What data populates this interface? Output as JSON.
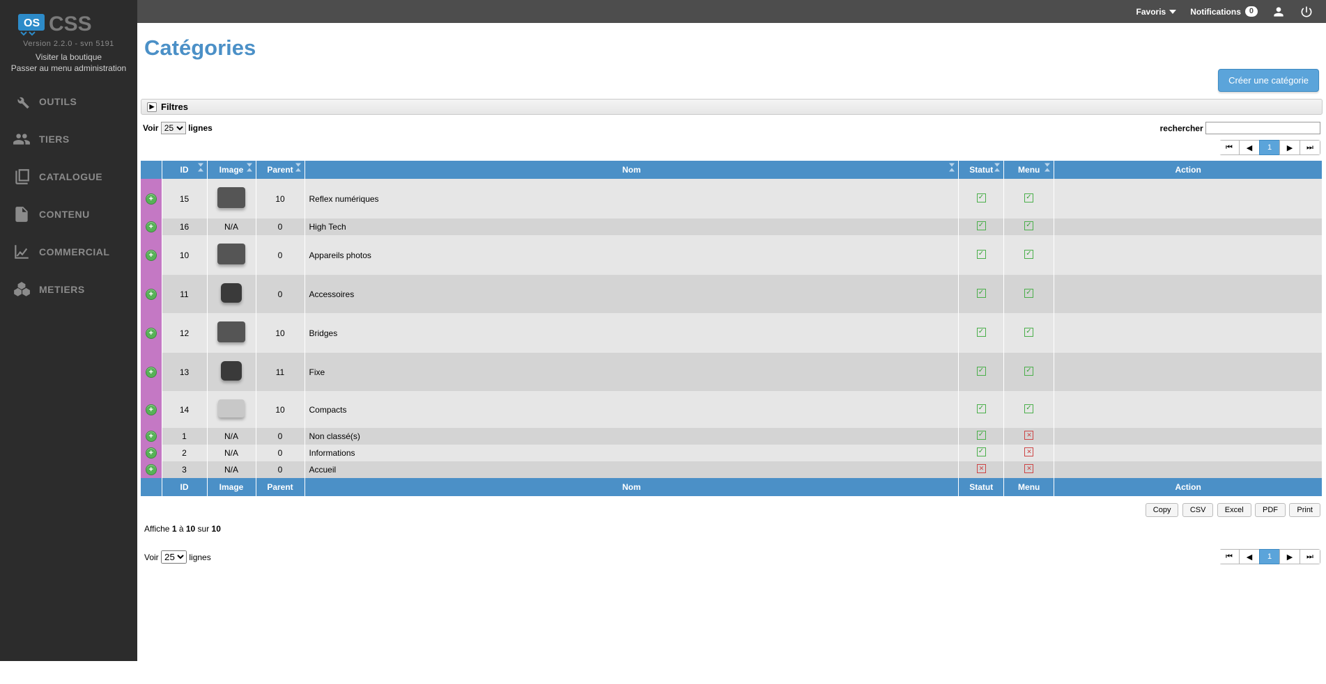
{
  "topbar": {
    "favoris": "Favoris",
    "notifications": "Notifications",
    "notif_count": "0"
  },
  "sidebar": {
    "version": "Version 2.2.0 - svn 5191",
    "visit_shop": "Visiter la boutique",
    "admin_menu": "Passer au menu administration",
    "items": [
      {
        "label": "OUTILS"
      },
      {
        "label": "TIERS"
      },
      {
        "label": "CATALOGUE"
      },
      {
        "label": "CONTENU"
      },
      {
        "label": "COMMERCIAL"
      },
      {
        "label": "METIERS"
      }
    ]
  },
  "page": {
    "title": "Catégories",
    "create_btn": "Créer une catégorie",
    "filters_label": "Filtres"
  },
  "table": {
    "show_label": "Voir",
    "lines_label": "lignes",
    "page_size": "25",
    "search_label": "rechercher",
    "headers": {
      "id": "ID",
      "image": "Image",
      "parent": "Parent",
      "name": "Nom",
      "status": "Statut",
      "menu": "Menu",
      "action": "Action"
    },
    "rows": [
      {
        "id": "15",
        "image": "camera",
        "parent": "10",
        "name": "Reflex numériques",
        "status": true,
        "menu": true
      },
      {
        "id": "16",
        "image": "na",
        "parent": "0",
        "name": "High Tech",
        "status": true,
        "menu": true
      },
      {
        "id": "10",
        "image": "camera",
        "parent": "0",
        "name": "Appareils photos",
        "status": true,
        "menu": true
      },
      {
        "id": "11",
        "image": "lens",
        "parent": "0",
        "name": "Accessoires",
        "status": true,
        "menu": true
      },
      {
        "id": "12",
        "image": "camera",
        "parent": "10",
        "name": "Bridges",
        "status": true,
        "menu": true
      },
      {
        "id": "13",
        "image": "lens",
        "parent": "11",
        "name": "Fixe",
        "status": true,
        "menu": true
      },
      {
        "id": "14",
        "image": "compact",
        "parent": "10",
        "name": "Compacts",
        "status": true,
        "menu": true
      },
      {
        "id": "1",
        "image": "na",
        "parent": "0",
        "name": "Non classé(s)",
        "status": true,
        "menu": false
      },
      {
        "id": "2",
        "image": "na",
        "parent": "0",
        "name": "Informations",
        "status": true,
        "menu": false
      },
      {
        "id": "3",
        "image": "na",
        "parent": "0",
        "name": "Accueil",
        "status": false,
        "menu": false
      }
    ],
    "na_text": "N/A",
    "info_prefix": "Affiche ",
    "info_from": "1",
    "info_a": " à ",
    "info_to": "10",
    "info_sur": " sur ",
    "info_total": "10",
    "page_number": "1"
  },
  "export": {
    "copy": "Copy",
    "csv": "CSV",
    "excel": "Excel",
    "pdf": "PDF",
    "print": "Print"
  }
}
